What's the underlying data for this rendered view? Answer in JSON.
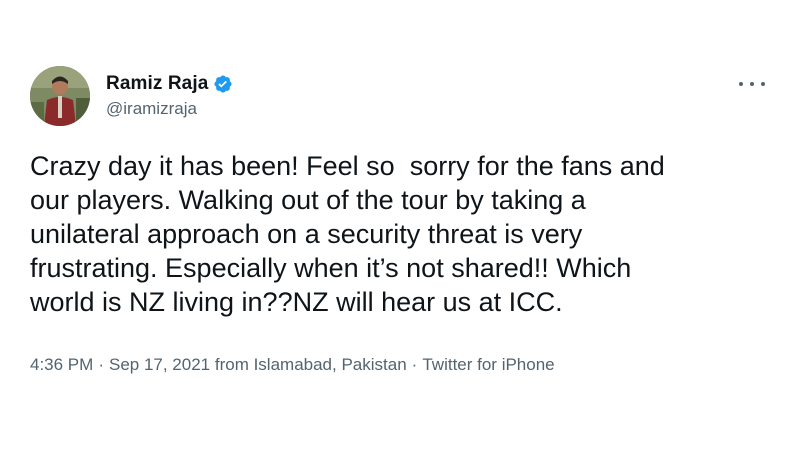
{
  "author": {
    "display_name": "Ramiz Raja",
    "handle": "@iramizraja",
    "verified": true
  },
  "tweet": {
    "text": "Crazy day it has been! Feel so  sorry for the fans and\nour players. Walking out of the tour by taking a\nunilateral approach on a security threat is very\nfrustrating. Especially when it’s not shared!! Which\nworld is NZ living in??NZ will hear us at ICC."
  },
  "meta": {
    "time": "4:36 PM",
    "separator": "·",
    "date_location": "Sep 17, 2021 from Islamabad, Pakistan",
    "client": "Twitter for iPhone"
  },
  "icons": {
    "verified": "verified-badge-icon",
    "more": "more-options-icon"
  },
  "colors": {
    "verified_blue": "#1d9bf0",
    "secondary_text": "#536471",
    "primary_text": "#0f1419"
  }
}
